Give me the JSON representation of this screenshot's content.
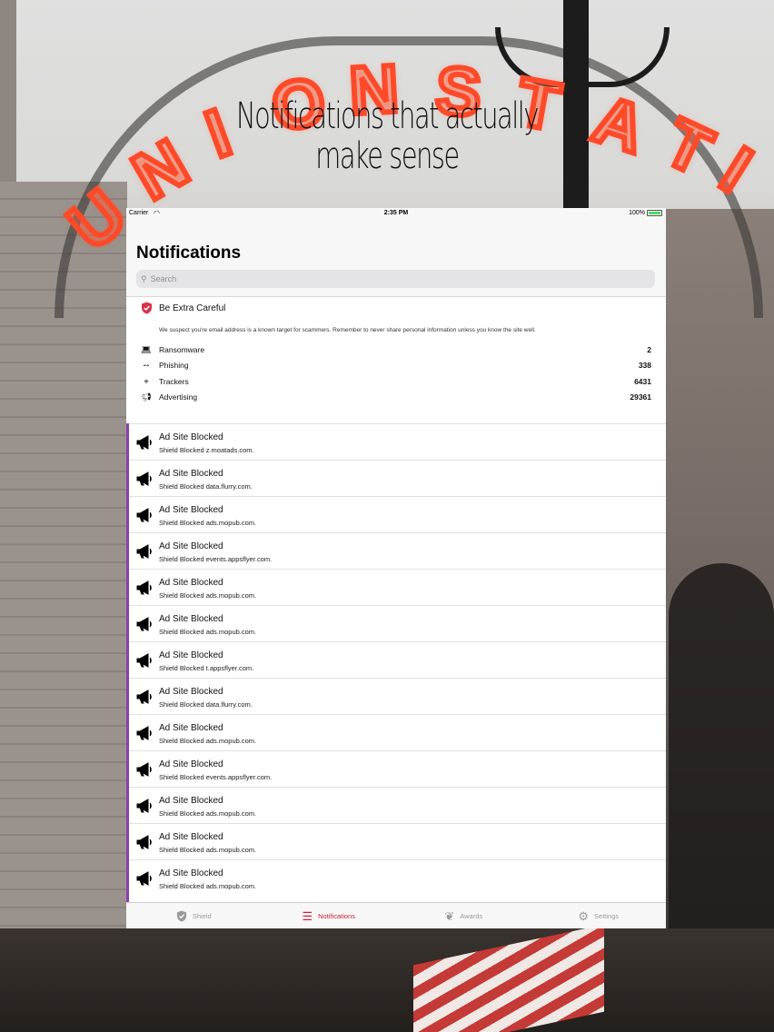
{
  "headline": {
    "line1": "Notifications that actually",
    "line2": "make sense"
  },
  "background": {
    "sign_letters": [
      "U",
      "N",
      "I",
      "O",
      "N",
      "S",
      "T",
      "A",
      "T",
      "I"
    ]
  },
  "status_bar": {
    "carrier": "Carrier",
    "time": "2:35 PM",
    "battery": "100%"
  },
  "nav": {
    "title": "Notifications",
    "search_placeholder": "Search"
  },
  "warning": {
    "title": "Be Extra Careful",
    "message": "We suspect you're email address is a known target for scammers.  Remember to never share personal information unless you know the site well."
  },
  "stats": [
    {
      "icon": "laptop-icon",
      "label": "Ransomware",
      "count": "2"
    },
    {
      "icon": "hook-icon",
      "label": "Phishing",
      "count": "338"
    },
    {
      "icon": "crosshair-icon",
      "label": "Trackers",
      "count": "6431"
    },
    {
      "icon": "megaphone-icon",
      "label": "Advertising",
      "count": "29361"
    }
  ],
  "notifications": [
    {
      "title": "Ad Site Blocked",
      "subtitle": "Shield Blocked z.moatads.com."
    },
    {
      "title": "Ad Site Blocked",
      "subtitle": "Shield Blocked data.flurry.com."
    },
    {
      "title": "Ad Site Blocked",
      "subtitle": "Shield Blocked ads.mopub.com."
    },
    {
      "title": "Ad Site Blocked",
      "subtitle": "Shield Blocked events.appsflyer.com."
    },
    {
      "title": "Ad Site Blocked",
      "subtitle": "Shield Blocked ads.mopub.com."
    },
    {
      "title": "Ad Site Blocked",
      "subtitle": "Shield Blocked ads.mopub.com."
    },
    {
      "title": "Ad Site Blocked",
      "subtitle": "Shield Blocked t.appsflyer.com."
    },
    {
      "title": "Ad Site Blocked",
      "subtitle": "Shield Blocked data.flurry.com."
    },
    {
      "title": "Ad Site Blocked",
      "subtitle": "Shield Blocked ads.mopub.com."
    },
    {
      "title": "Ad Site Blocked",
      "subtitle": "Shield Blocked events.appsflyer.com."
    },
    {
      "title": "Ad Site Blocked",
      "subtitle": "Shield Blocked ads.mopub.com."
    },
    {
      "title": "Ad Site Blocked",
      "subtitle": "Shield Blocked ads.mopub.com."
    },
    {
      "title": "Ad Site Blocked",
      "subtitle": "Shield Blocked ads.mopub.com."
    }
  ],
  "tabs": [
    {
      "label": "Shield",
      "icon": "shield-icon",
      "active": false
    },
    {
      "label": "Notifications",
      "icon": "list-icon",
      "active": true
    },
    {
      "label": "Awards",
      "icon": "laurel-icon",
      "active": false
    },
    {
      "label": "Settings",
      "icon": "gear-icon",
      "active": false
    }
  ],
  "colors": {
    "accent": "#c8243a",
    "list_accent": "#8c3fb4",
    "shield": "#d8334a"
  }
}
